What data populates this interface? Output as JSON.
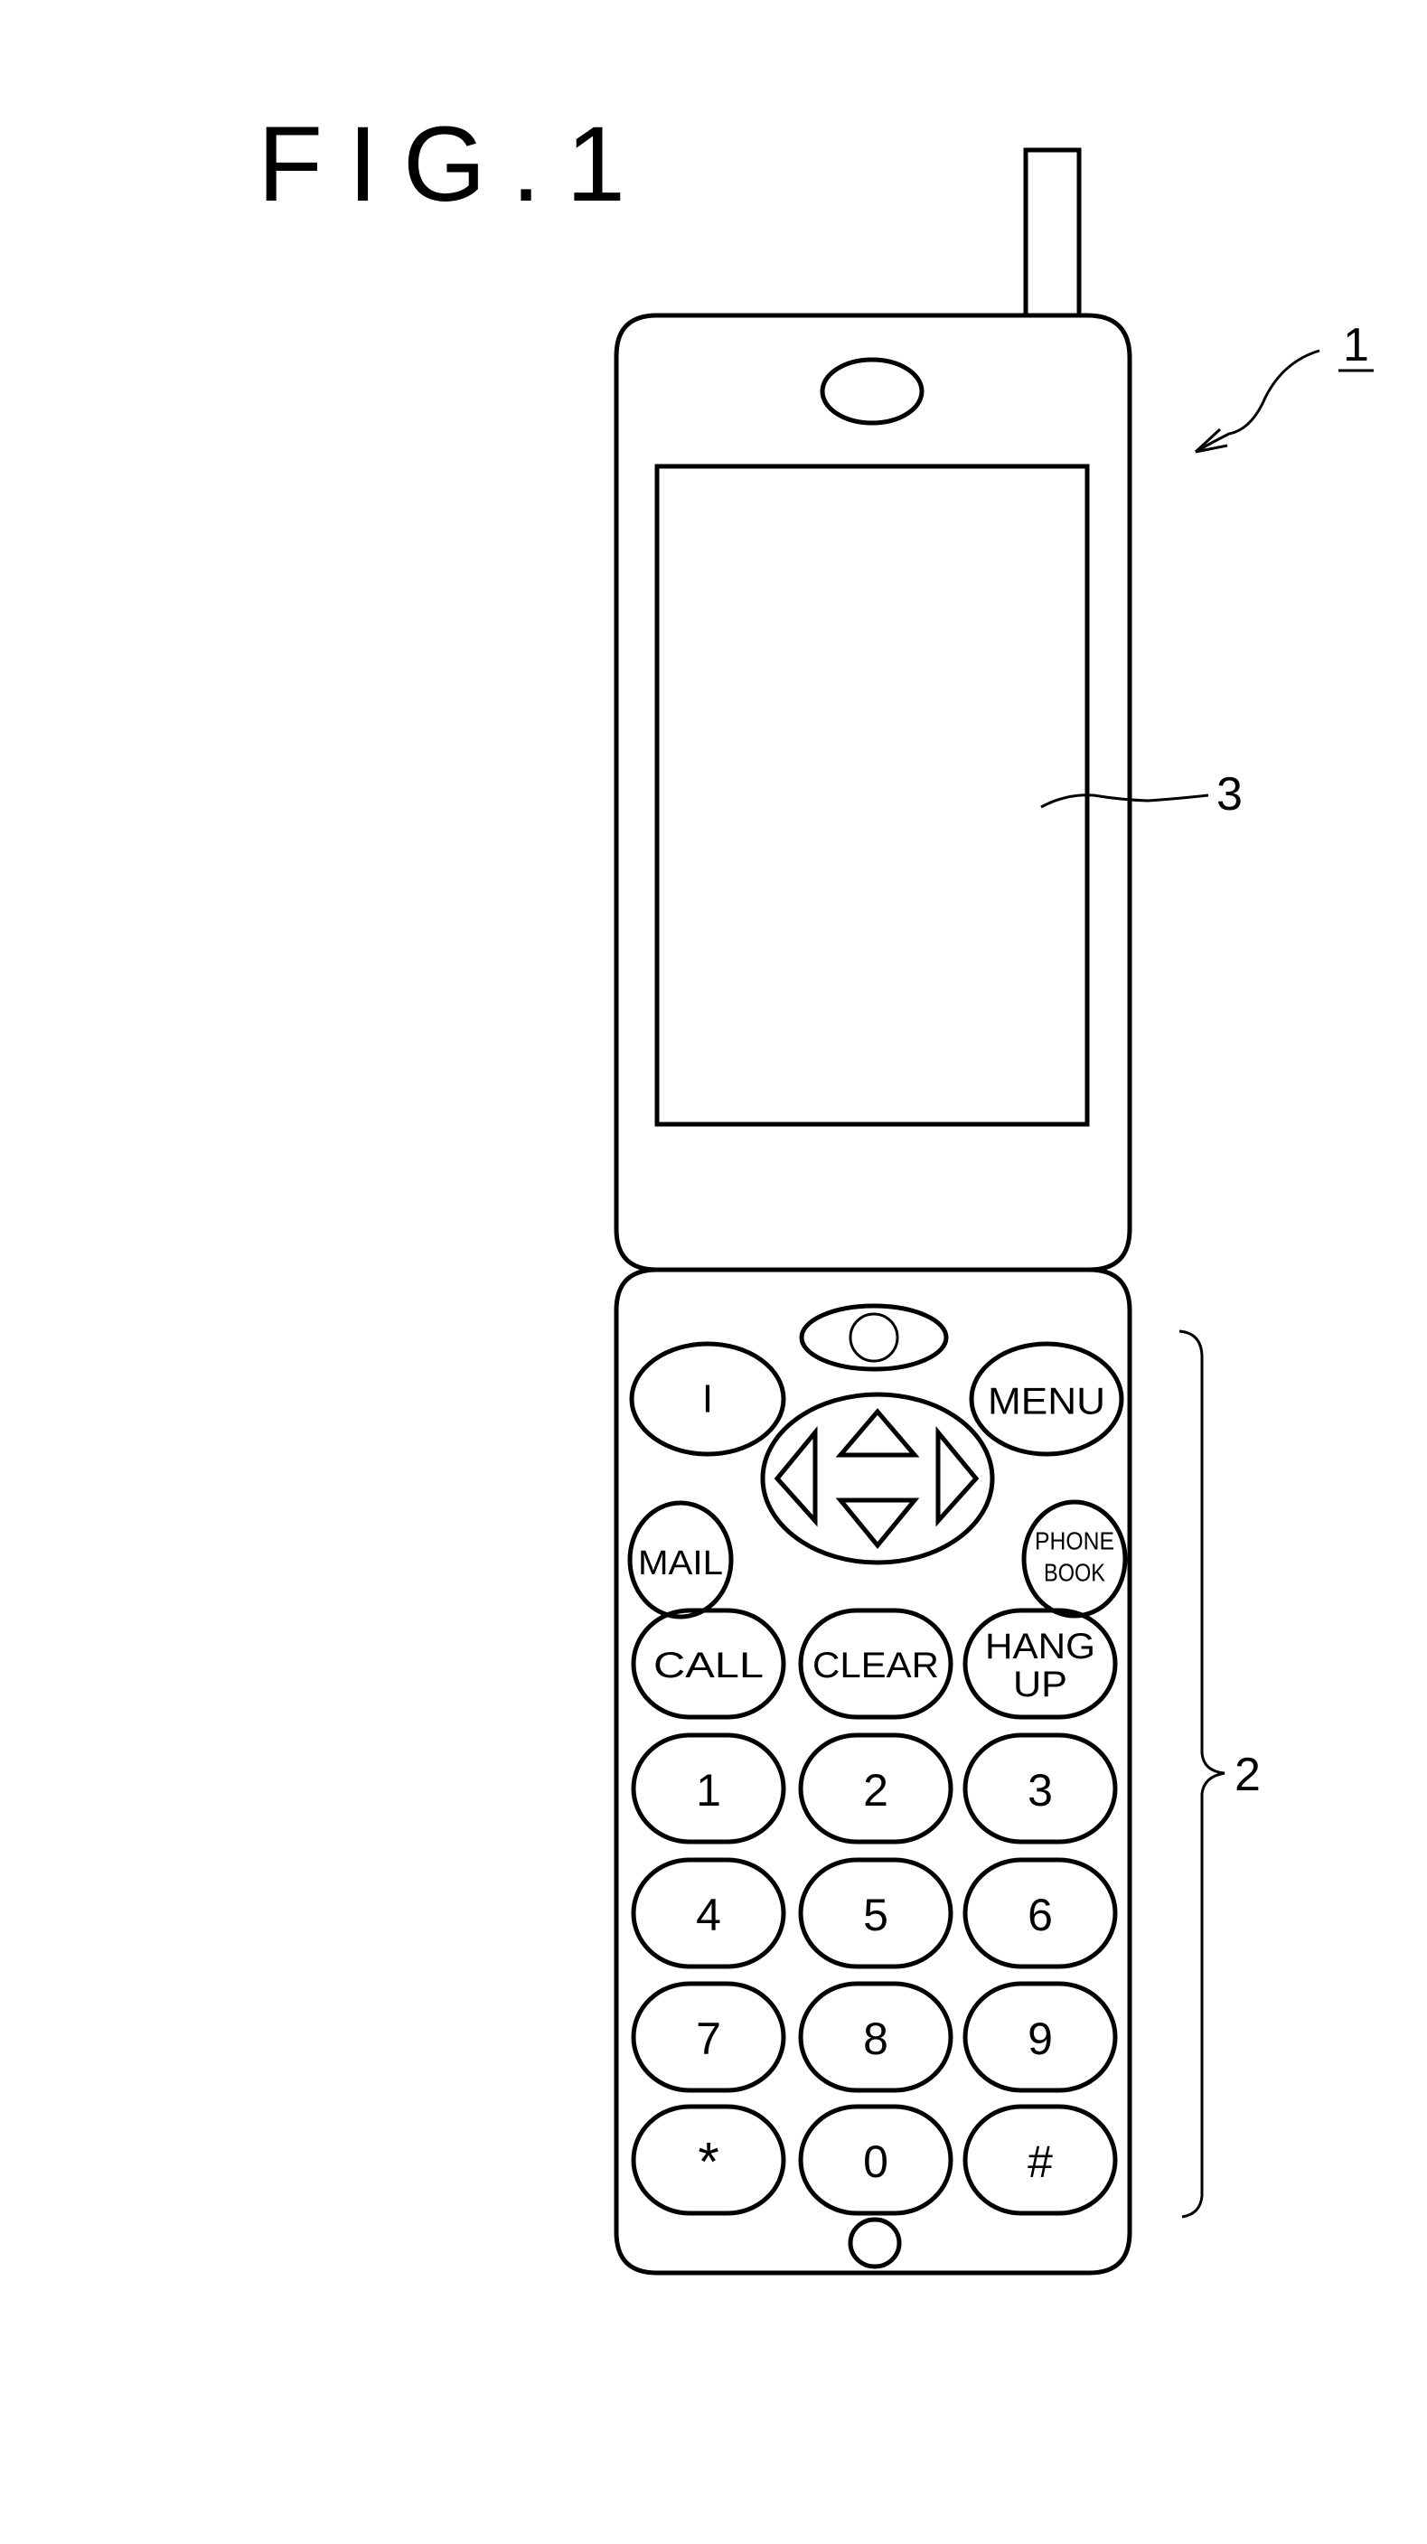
{
  "figure": {
    "title": "FIG.1",
    "reference_labels": {
      "phone": "1",
      "keypad": "2",
      "display": "3"
    }
  },
  "phone": {
    "upper_keys": {
      "left_soft": "I",
      "menu": "MENU",
      "mail": "MAIL",
      "phonebook_line1": "PHONE",
      "phonebook_line2": "BOOK"
    },
    "dpad": [
      "up",
      "down",
      "left",
      "right"
    ],
    "call_row": {
      "call": "CALL",
      "clear": "CLEAR",
      "hangup_line1": "HANG",
      "hangup_line2": "UP"
    },
    "number_keys": [
      "1",
      "2",
      "3",
      "4",
      "5",
      "6",
      "7",
      "8",
      "9",
      "*",
      "0",
      "#"
    ]
  }
}
